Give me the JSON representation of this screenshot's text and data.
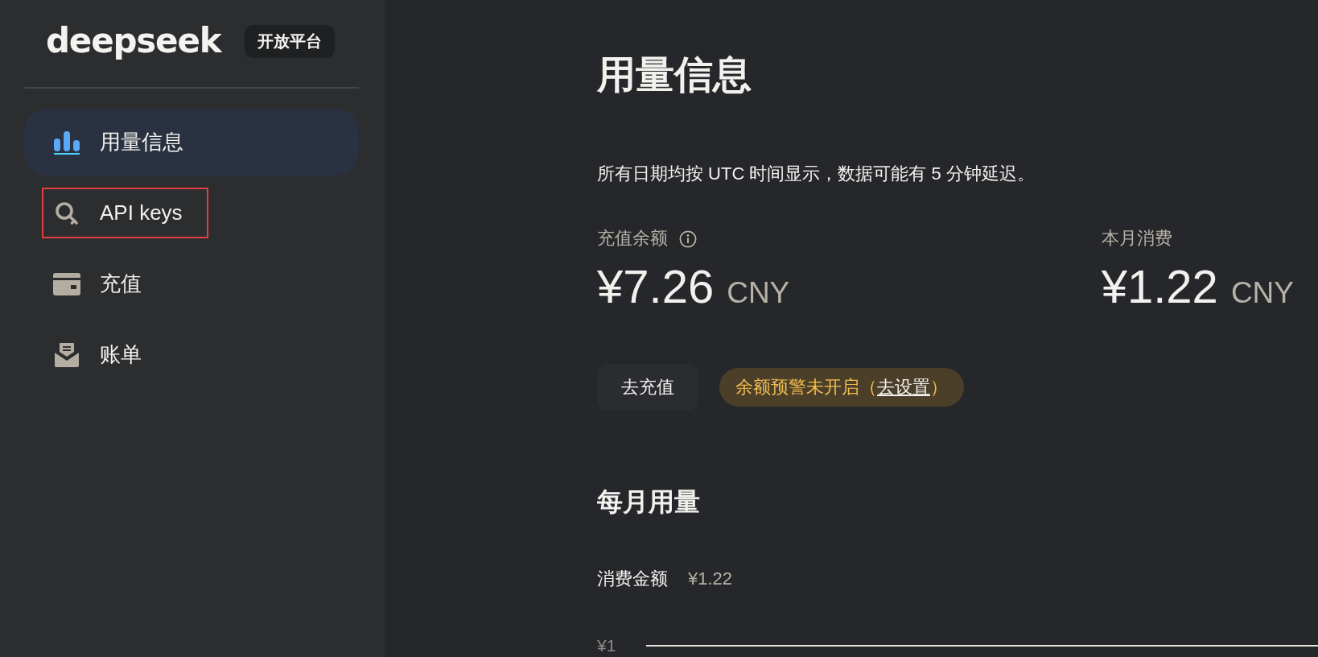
{
  "sidebar": {
    "logo": "deepseek",
    "badge": "开放平台",
    "items": [
      {
        "label": "用量信息",
        "selected": true,
        "highlighted": false
      },
      {
        "label": "API keys",
        "selected": false,
        "highlighted": true
      },
      {
        "label": "充值",
        "selected": false,
        "highlighted": false
      },
      {
        "label": "账单",
        "selected": false,
        "highlighted": false
      }
    ]
  },
  "main": {
    "title": "用量信息",
    "note": "所有日期均按 UTC 时间显示，数据可能有 5 分钟延迟。",
    "stats": [
      {
        "label": "充值余额",
        "info_icon": true,
        "amount": "¥7.26",
        "currency": "CNY"
      },
      {
        "label": "本月消费",
        "info_icon": false,
        "amount": "¥1.22",
        "currency": "CNY"
      }
    ],
    "topup_button": "去充值",
    "balance_alert": {
      "text": "余额预警未开启（",
      "link": "去设置",
      "suffix": "）"
    },
    "monthly": {
      "title": "每月用量",
      "metric_label": "消费金额",
      "metric_value": "¥1.22",
      "chart": {
        "y_ticks": [
          "¥1"
        ]
      }
    }
  }
}
